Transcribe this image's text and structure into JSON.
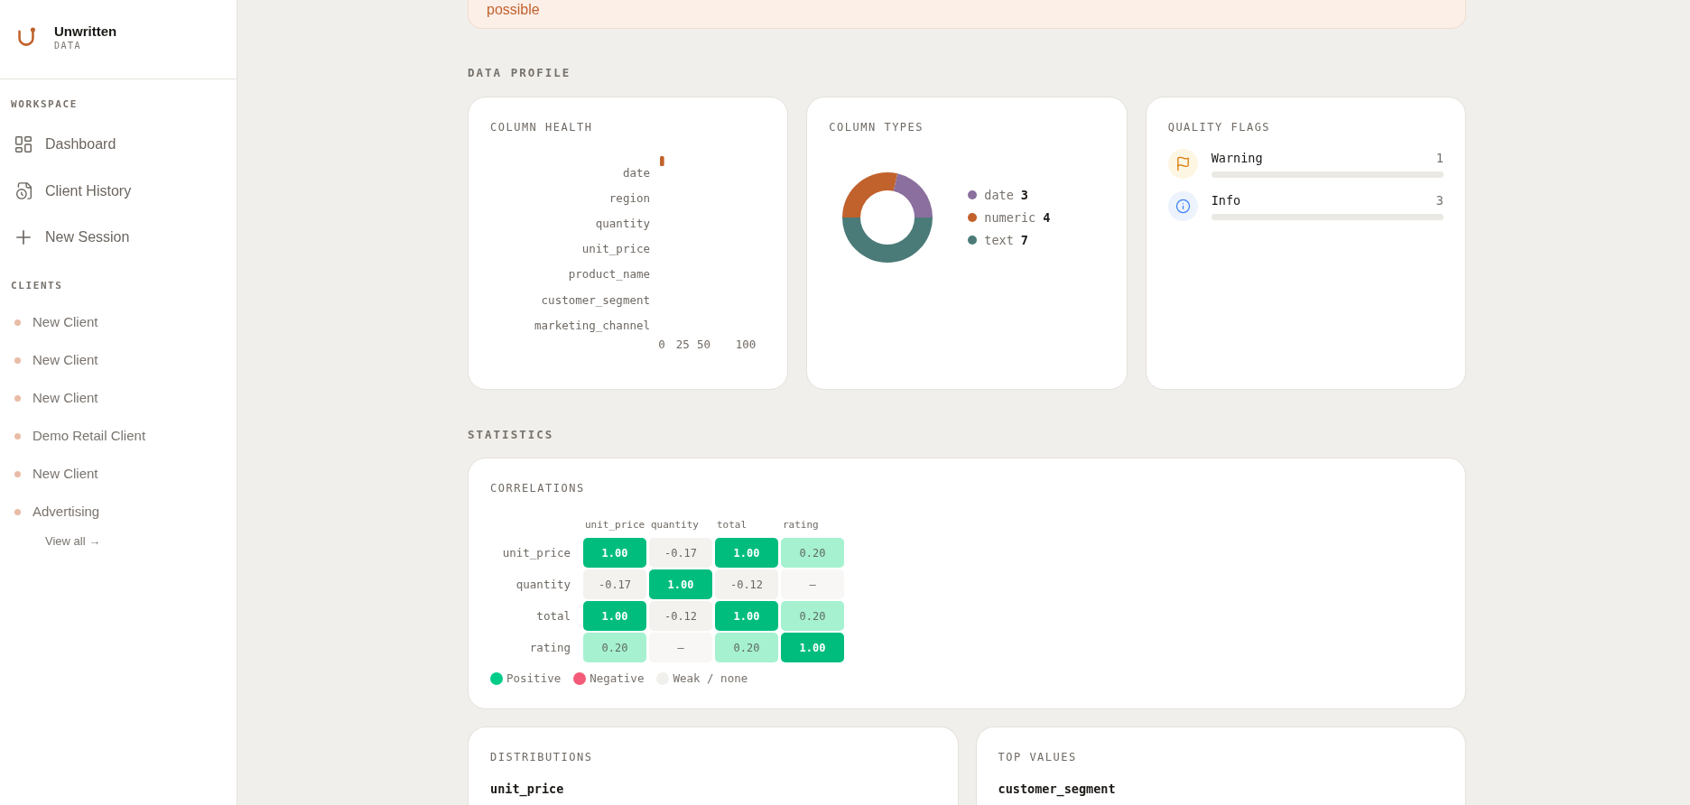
{
  "sidebar": {
    "brand": {
      "name": "Unwritten",
      "subtitle": "DATA"
    },
    "workspace": {
      "title": "WORKSPACE",
      "items": [
        {
          "kind": "dashboard",
          "label": "Dashboard"
        },
        {
          "kind": "history",
          "label": "Client History"
        },
        {
          "kind": "add",
          "label": "New Session"
        }
      ]
    },
    "clients": {
      "title": "CLIENTS",
      "items": [
        "New Client",
        "New Client",
        "New Client",
        "Demo Retail Client",
        "New Client",
        "Advertising"
      ],
      "view_all": "View all →"
    }
  },
  "banner": {
    "text": "possible"
  },
  "data_profile": {
    "title": "DATA PROFILE",
    "column_health": {
      "title": "COLUMN HEALTH",
      "chart_data": {
        "type": "bar",
        "orientation": "horizontal",
        "categories": [
          "date",
          "region",
          "quantity",
          "unit_price",
          "product_name",
          "customer_segment",
          "marketing_channel"
        ],
        "values": [
          5,
          0,
          0,
          0,
          0,
          0,
          0
        ],
        "xlim": [
          0,
          100
        ],
        "xticks": [
          0,
          25,
          50,
          100
        ]
      }
    },
    "column_types": {
      "title": "COLUMN TYPES",
      "chart_data": {
        "type": "donut",
        "categories": [
          "date",
          "numeric",
          "text"
        ],
        "values": [
          21.43,
          28.57,
          50
        ]
      },
      "legend": [
        {
          "count": "3",
          "color": "#8b6f9e"
        },
        {
          "count": "4",
          "color": "#c1622d"
        },
        {
          "count": "7",
          "color": "#4b7b78"
        }
      ]
    },
    "quality_flags": {
      "title": "QUALITY FLAGS",
      "items": [
        {
          "kind": "warning",
          "label": "Warning",
          "count": "1"
        },
        {
          "kind": "info",
          "label": "Info",
          "count": "3"
        }
      ]
    }
  },
  "statistics": {
    "title": "STATISTICS",
    "correlations": {
      "title": "CORRELATIONS",
      "columns": [
        "unit_price",
        "quantity",
        "total",
        "rating"
      ],
      "rows": [
        {
          "label": "unit_price",
          "cells": [
            {
              "value": "1.00",
              "kind": "strong"
            },
            {
              "value": "-0.17",
              "kind": "weak"
            },
            {
              "value": "1.00",
              "kind": "strong"
            },
            {
              "value": "0.20",
              "kind": "moderate"
            }
          ]
        },
        {
          "label": "quantity",
          "cells": [
            {
              "value": "-0.17",
              "kind": "weak"
            },
            {
              "value": "1.00",
              "kind": "strong"
            },
            {
              "value": "-0.12",
              "kind": "weak"
            },
            {
              "value": "—",
              "kind": "none"
            }
          ]
        },
        {
          "label": "total",
          "cells": [
            {
              "value": "1.00",
              "kind": "strong"
            },
            {
              "value": "-0.12",
              "kind": "weak"
            },
            {
              "value": "1.00",
              "kind": "strong"
            },
            {
              "value": "0.20",
              "kind": "moderate"
            }
          ]
        },
        {
          "label": "rating",
          "cells": [
            {
              "value": "0.20",
              "kind": "moderate"
            },
            {
              "value": "—",
              "kind": "none"
            },
            {
              "value": "0.20",
              "kind": "moderate"
            },
            {
              "value": "1.00",
              "kind": "strong"
            }
          ]
        }
      ],
      "legend": [
        {
          "label": "Positive",
          "color": "#00cc8a"
        },
        {
          "label": "Negative",
          "color": "#f45b78"
        },
        {
          "label": "Weak / none",
          "color": "#f1f0ed"
        }
      ]
    },
    "distributions": {
      "title": "DISTRIBUTIONS",
      "field": "unit_price"
    },
    "top_values": {
      "title": "TOP VALUES",
      "field": "customer_segment"
    }
  }
}
